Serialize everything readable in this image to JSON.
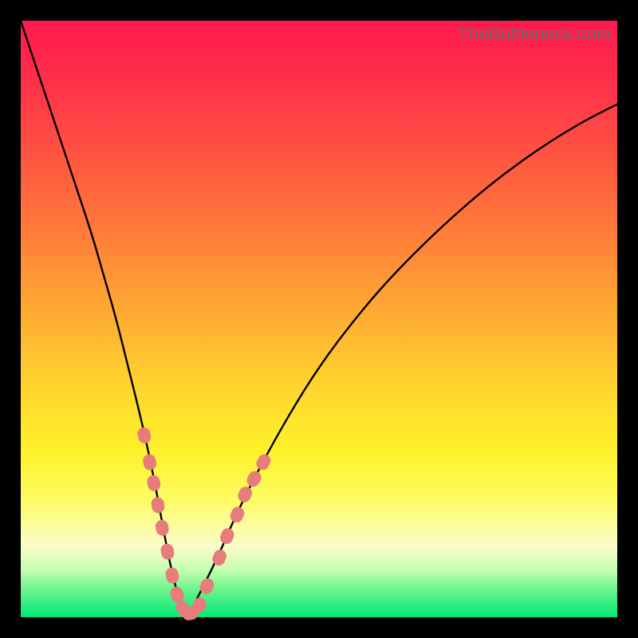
{
  "watermark": "TheBottleneck.com",
  "colors": {
    "frame": "#000000",
    "curve": "#000000",
    "marker": "#e77c7c",
    "gradient_top": "#ff1a4d",
    "gradient_bottom": "#00e878"
  },
  "chart_data": {
    "type": "line",
    "title": "",
    "xlabel": "",
    "ylabel": "",
    "xlim": [
      0,
      100
    ],
    "ylim": [
      0,
      100
    ],
    "grid": false,
    "legend": false,
    "series": [
      {
        "name": "curve",
        "x": [
          0,
          3,
          6,
          9,
          12,
          14,
          16,
          18,
          20,
          22,
          23.5,
          25,
          26.5,
          28,
          30,
          33,
          36,
          40,
          45,
          50,
          56,
          62,
          70,
          78,
          86,
          94,
          100
        ],
        "y": [
          100,
          91,
          82,
          73,
          64,
          57,
          50,
          42,
          34,
          25,
          17,
          9,
          3,
          0,
          4,
          10,
          17,
          25,
          34,
          42,
          50,
          57,
          65,
          72,
          78,
          83,
          86
        ]
      }
    ],
    "markers": {
      "name": "highlighted-points",
      "color": "#e77c7c",
      "points": [
        {
          "x": 20.7,
          "y": 30.5
        },
        {
          "x": 21.6,
          "y": 26.0
        },
        {
          "x": 22.3,
          "y": 22.5
        },
        {
          "x": 23.0,
          "y": 18.8
        },
        {
          "x": 23.7,
          "y": 15.0
        },
        {
          "x": 24.6,
          "y": 11.0
        },
        {
          "x": 25.4,
          "y": 7.0
        },
        {
          "x": 26.2,
          "y": 3.8
        },
        {
          "x": 27.2,
          "y": 1.5
        },
        {
          "x": 28.4,
          "y": 0.6
        },
        {
          "x": 29.9,
          "y": 2.0
        },
        {
          "x": 31.2,
          "y": 5.2
        },
        {
          "x": 33.3,
          "y": 10.0
        },
        {
          "x": 34.6,
          "y": 13.6
        },
        {
          "x": 36.3,
          "y": 17.2
        },
        {
          "x": 37.6,
          "y": 20.6
        },
        {
          "x": 39.1,
          "y": 23.2
        },
        {
          "x": 40.7,
          "y": 26.0
        }
      ]
    }
  }
}
